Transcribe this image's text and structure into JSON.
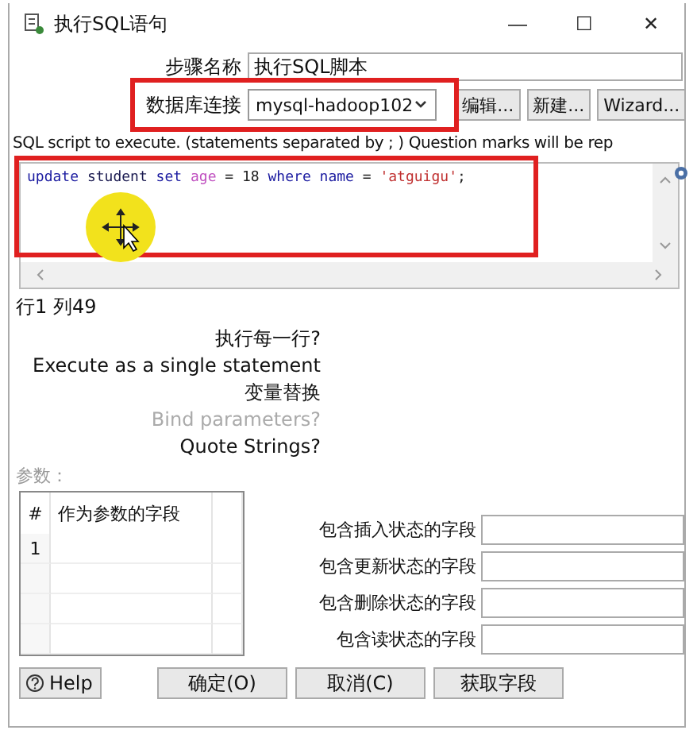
{
  "window": {
    "title": "执行SQL语句",
    "controls": [
      "—",
      "☐",
      "✕"
    ]
  },
  "step_name": {
    "label": "步骤名称",
    "value": "执行SQL脚本"
  },
  "connection": {
    "label": "数据库连接",
    "value": "mysql-hadoop102",
    "highlighted": true,
    "buttons": [
      "编辑...",
      "新建...",
      "Wizard..."
    ]
  },
  "sql_hint": "SQL script to execute. (statements separated by ; ) Question marks will be rep",
  "sql_editor": {
    "highlighted": true,
    "cursor_highlight": true,
    "tokens": [
      {
        "kind": "keyword",
        "text": "update "
      },
      {
        "kind": "identifier",
        "text": "student "
      },
      {
        "kind": "keyword",
        "text": "set "
      },
      {
        "kind": "field",
        "text": "age "
      },
      {
        "kind": "plain",
        "text": "= 18 "
      },
      {
        "kind": "keyword",
        "text": "where name "
      },
      {
        "kind": "plain",
        "text": "= "
      },
      {
        "kind": "string",
        "text": "'atguigu'"
      },
      {
        "kind": "plain",
        "text": ";"
      }
    ]
  },
  "position": "行1 列49",
  "options": [
    {
      "label": "执行每一行?",
      "disabled": false
    },
    {
      "label": "Execute as a single statement",
      "disabled": false
    },
    {
      "label": "变量替换",
      "disabled": false
    },
    {
      "label": "Bind parameters?",
      "disabled": true
    },
    {
      "label": "Quote Strings?",
      "disabled": false
    }
  ],
  "parameters": {
    "label": "参数：",
    "columns": [
      "#",
      "作为参数的字段"
    ],
    "rows": [
      [
        "1"
      ]
    ]
  },
  "status_fields": [
    {
      "label": "包含插入状态的字段"
    },
    {
      "label": "包含更新状态的字段"
    },
    {
      "label": "包含删除状态的字段"
    },
    {
      "label": "包含读状态的字段"
    }
  ],
  "buttons": [
    {
      "kind": "help",
      "label": "Help"
    },
    {
      "kind": "plain",
      "label": "确定(O)"
    },
    {
      "kind": "plain",
      "label": "取消(C)"
    },
    {
      "kind": "plain",
      "label": "获取字段"
    }
  ]
}
